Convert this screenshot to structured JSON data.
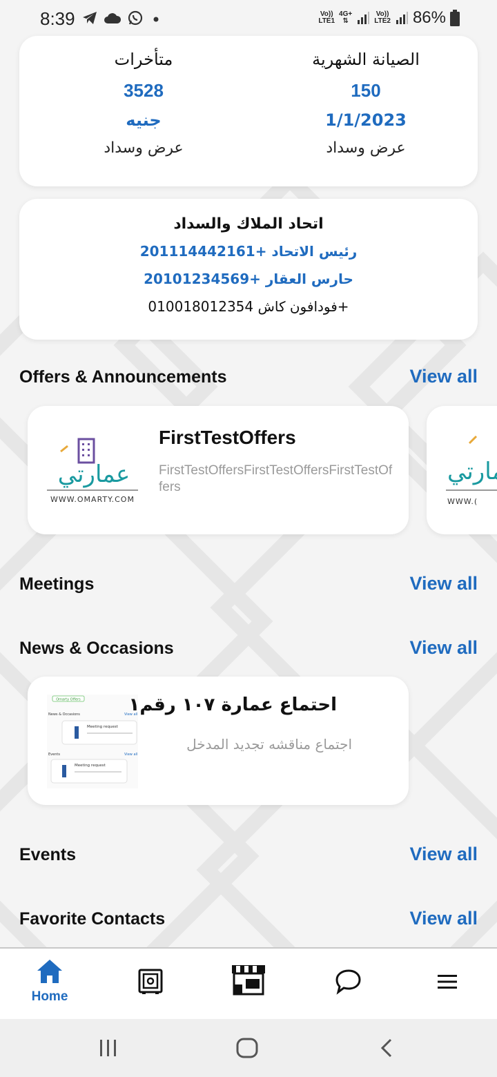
{
  "status_bar": {
    "time": "8:39",
    "net1": [
      "Vo))",
      "LTE1"
    ],
    "net2": [
      "4G+",
      ""
    ],
    "net3": [
      "Vo))",
      "LTE2"
    ],
    "battery": "86%"
  },
  "summary": {
    "monthly": {
      "title": "الصيانة الشهرية",
      "value": "150",
      "date": "1/1/2023",
      "action": "عرض وسداد"
    },
    "arrears": {
      "title": "متأخرات",
      "value": "3528",
      "currency": "جنيه",
      "action": "عرض وسداد"
    }
  },
  "union": {
    "title": "اتحاد الملاك والسداد",
    "president": "رئيس الاتحاد +201114442161",
    "guard": "حارس العقار +20101234569",
    "wallet": "+فودافون كاش 010018012354"
  },
  "sections": {
    "offers": "Offers & Announcements",
    "meetings": "Meetings",
    "news": "News & Occasions",
    "events": "Events",
    "favorites": "Favorite Contacts",
    "view_all": "View all"
  },
  "offer": {
    "title": "FirstTestOffers",
    "description": "FirstTestOffersFirstTestOffersFirstTestOffers",
    "logo_text": "عمارتي",
    "logo_url": "WWW.OMARTY.COM",
    "logo_url_partial": "WWW.("
  },
  "news": {
    "title": "احتماع عمارة ١٠٧ رقم١",
    "description": "اجتماع مناقشه تجديد المدخل",
    "thumb": {
      "tag": "Omarty Offers",
      "heading1": "News & Occasions",
      "heading2": "Events",
      "viewall": "View all",
      "item": "Meeting request"
    }
  },
  "bottom_nav": {
    "home": "Home"
  },
  "colors": {
    "accent": "#1f6bbf",
    "logo_teal": "#1a9aa0",
    "logo_orange": "#e8a93a",
    "logo_purple": "#6b4fa0"
  }
}
